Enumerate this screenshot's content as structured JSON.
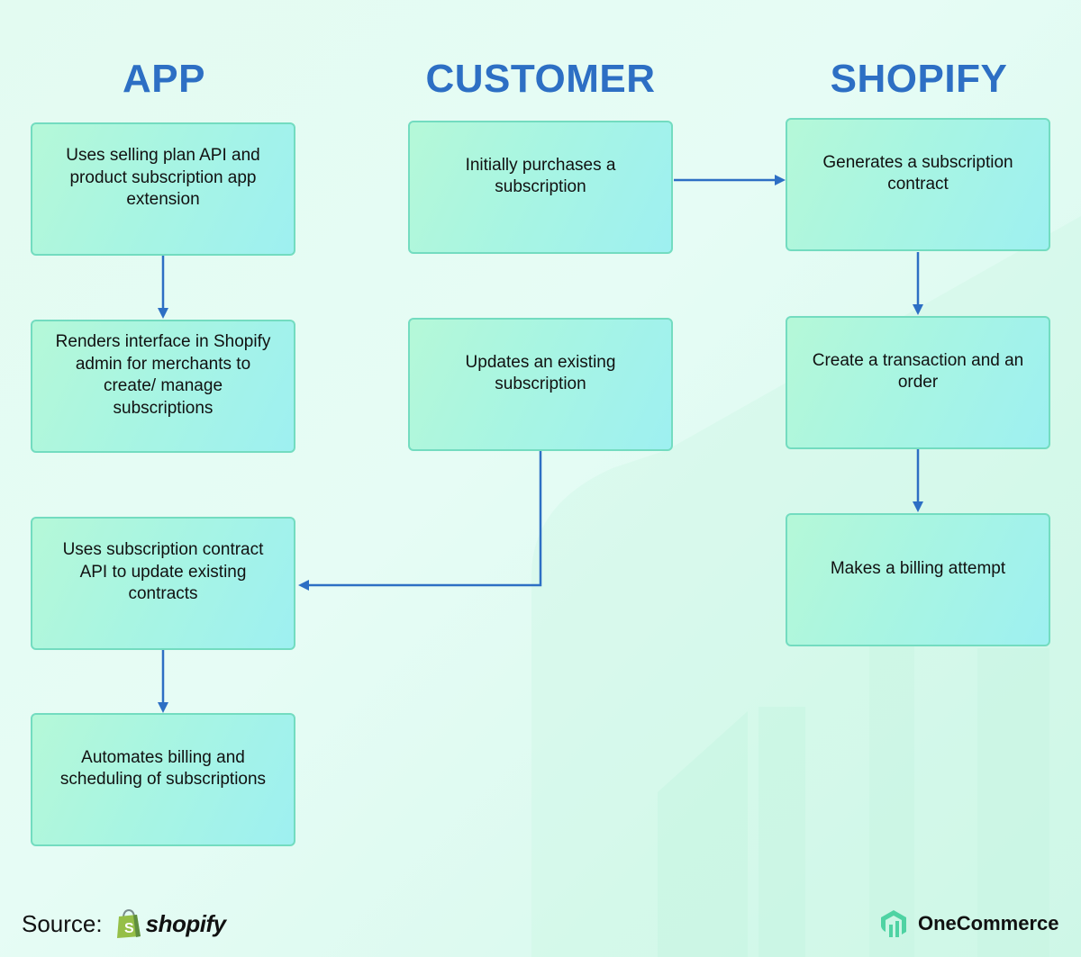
{
  "columns": {
    "app": "APP",
    "customer": "CUSTOMER",
    "shopify": "SHOPIFY"
  },
  "boxes": {
    "app_1": "Uses selling plan API and product subscription app extension",
    "app_2": "Renders interface in Shopify admin for merchants to create/ manage subscriptions",
    "app_3": "Uses subscription contract API to update existing contracts",
    "app_4": "Automates billing and scheduling of subscriptions",
    "customer_1": "Initially purchases a subscription",
    "customer_2": "Updates an existing subscription",
    "shopify_1": "Generates a subscription contract",
    "shopify_2": "Create a transaction and an order",
    "shopify_3": "Makes a billing attempt"
  },
  "edges": [
    {
      "from": "app_1",
      "to": "app_2"
    },
    {
      "from": "app_3",
      "to": "app_4"
    },
    {
      "from": "customer_1",
      "to": "shopify_1"
    },
    {
      "from": "customer_2",
      "to": "app_3"
    },
    {
      "from": "shopify_1",
      "to": "shopify_2"
    },
    {
      "from": "shopify_2",
      "to": "shopify_3"
    }
  ],
  "footer": {
    "source_label": "Source:",
    "source_brand": "shopify",
    "credit": "OneCommerce"
  },
  "colors": {
    "title": "#2d6fc4",
    "arrow": "#2d6fc4",
    "box_border": "#73dcc0",
    "logo_green": "#4fd3a3",
    "shopify_green": "#95bf47"
  }
}
